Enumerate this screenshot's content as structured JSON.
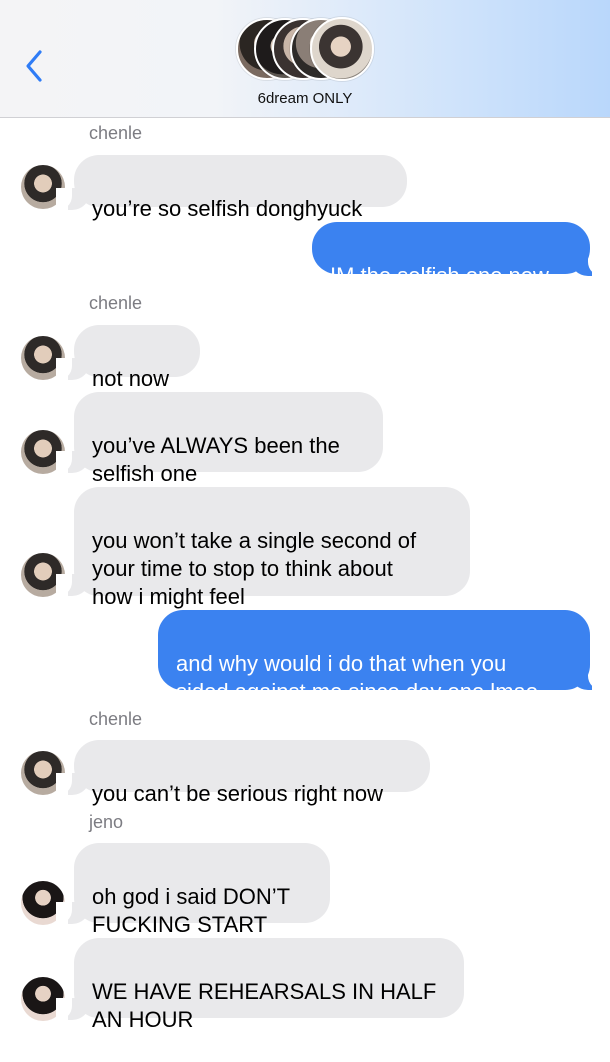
{
  "header": {
    "group_name": "6dream ONLY",
    "back_icon": "chevron-left-icon",
    "accent": "#2f7cf6"
  },
  "colors": {
    "incoming_bubble": "#e9e9eb",
    "outgoing_bubble": "#3b82f0",
    "sender_label": "#7c7c82"
  },
  "messages": [
    {
      "sender": "chenle"
    },
    {
      "text": "you’re so selfish donghyuck"
    },
    {
      "text": "IM the selfish one now"
    },
    {
      "sender": "chenle"
    },
    {
      "text": "not now"
    },
    {
      "text": "you’ve ALWAYS been the\nselfish one"
    },
    {
      "text": "you won’t take a single second of\nyour time to stop to think about\nhow i might feel"
    },
    {
      "text": "and why would i do that when you\nsided against me since day one lmao"
    },
    {
      "sender": "chenle"
    },
    {
      "text": "you can’t be serious right now"
    },
    {
      "sender": "jeno"
    },
    {
      "text": "oh god i said DON’T\nFUCKING START"
    },
    {
      "text": "WE HAVE REHEARSALS IN HALF\nAN HOUR"
    }
  ]
}
